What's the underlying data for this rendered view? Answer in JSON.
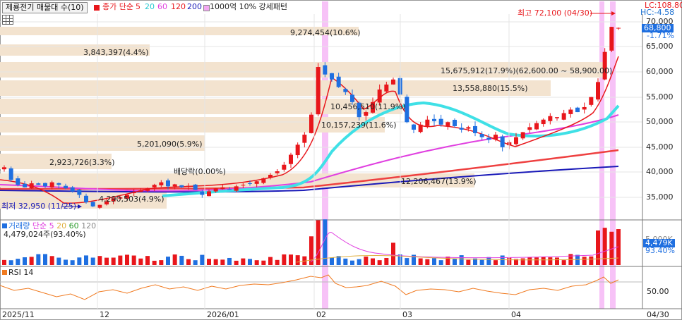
{
  "toolbar": {
    "indicator_select": "제룡전기 매물대 수(10)",
    "close_ma_label": "종가 단순",
    "ma_periods": [
      "5",
      "20",
      "60",
      "120",
      "200"
    ],
    "pattern_label": "1000억 10% 강세패턴"
  },
  "colors": {
    "up": "#e8161b",
    "down": "#1f6fe0",
    "ma5": "#e8161b",
    "ma20": "#3fe0e6",
    "ma60": "#e040e0",
    "ma120": "#e8161b",
    "ma200": "#1a1ab8",
    "volume_profile": "#f3e3cf",
    "highlight": "#f08ef0"
  },
  "price_axis": {
    "ticks": [
      "70,000",
      "65,000",
      "60,000",
      "55,000",
      "50,000",
      "45,000",
      "40,000",
      "35,000"
    ],
    "lc_label": "LC:108.80",
    "hc_label": "HC:-4.58",
    "current_price": "68,800",
    "current_change": "-1.71%"
  },
  "volume_axis": {
    "tick": "5,000K",
    "current_volume": "4,479K",
    "current_ratio": "93.40%"
  },
  "rsi_axis": {
    "tick": "50.00"
  },
  "date_axis": [
    "2025/11",
    "12",
    "2026/01",
    "02",
    "03",
    "04",
    "04/30"
  ],
  "annotations": {
    "high": "최고 72,100 (04/30)",
    "low": "최저 32,950 (11/25)",
    "dividend": "배당락(0.00%)"
  },
  "volume_profile_labels": [
    "9,274,454(10.6%)",
    "3,843,397(4.4%)",
    "15,675,912(17.9%)(62,600.00 ~ 58,900.00)",
    "13,558,880(15.5%)",
    "10,456,510(11.9%)",
    "10,157,239(11.6%)",
    "5,201,090(5.9%)",
    "2,923,726(3.3%)",
    "12,206,467(13.9%)",
    "4,290,503(4.9%)"
  ],
  "volume_panel": {
    "title": "거래량",
    "ma_label": "단순",
    "ma_periods": [
      "5",
      "20",
      "60",
      "120"
    ],
    "value_label": "4,479,024주(93.40%)"
  },
  "rsi_panel": {
    "title": "RSI 14"
  },
  "chart_data": {
    "type": "candlestick",
    "y_ticks": [
      70000,
      65000,
      60000,
      55000,
      50000,
      45000,
      40000,
      35000
    ],
    "high": 72100,
    "low": 32950,
    "current_price": 68800,
    "volume_profile": [
      {
        "volume": 9274454,
        "pct": 10.6
      },
      {
        "volume": 3843397,
        "pct": 4.4
      },
      {
        "volume": 15675912,
        "pct": 17.9,
        "range": [
          62600,
          58900
        ]
      },
      {
        "volume": 13558880,
        "pct": 15.5
      },
      {
        "volume": 10456510,
        "pct": 11.9
      },
      {
        "volume": 10157239,
        "pct": 11.6
      },
      {
        "volume": 5201090,
        "pct": 5.9
      },
      {
        "volume": 2923726,
        "pct": 3.3
      },
      {
        "volume": 12206467,
        "pct": 13.9
      },
      {
        "volume": 4290503,
        "pct": 4.9
      }
    ],
    "closes": [
      41000,
      38500,
      37500,
      37000,
      37800,
      37500,
      37200,
      38000,
      37500,
      36800,
      36200,
      35500,
      34000,
      33200,
      33500,
      34200,
      34800,
      35000,
      35500,
      36000,
      36400,
      36800,
      37500,
      38000,
      37200,
      37600,
      37000,
      37300,
      36500,
      35500,
      36200,
      36800,
      37000,
      36600,
      37200,
      37500,
      37800,
      38200,
      38800,
      39500,
      40200,
      41500,
      43500,
      45500,
      47500,
      51500,
      61000,
      59500,
      58500,
      57000,
      56000,
      54000,
      51000,
      52000,
      54000,
      56500,
      57500,
      58500,
      55500,
      50000,
      48500,
      49500,
      50500,
      50200,
      49500,
      50000,
      49200,
      48500,
      49000,
      47800,
      47000,
      46500,
      47500,
      45000,
      46000,
      47000,
      48000,
      49000,
      49800,
      50500,
      51200,
      51000,
      51800,
      52500,
      52000,
      53000,
      55000,
      58000,
      64000,
      69000,
      68800
    ]
  }
}
